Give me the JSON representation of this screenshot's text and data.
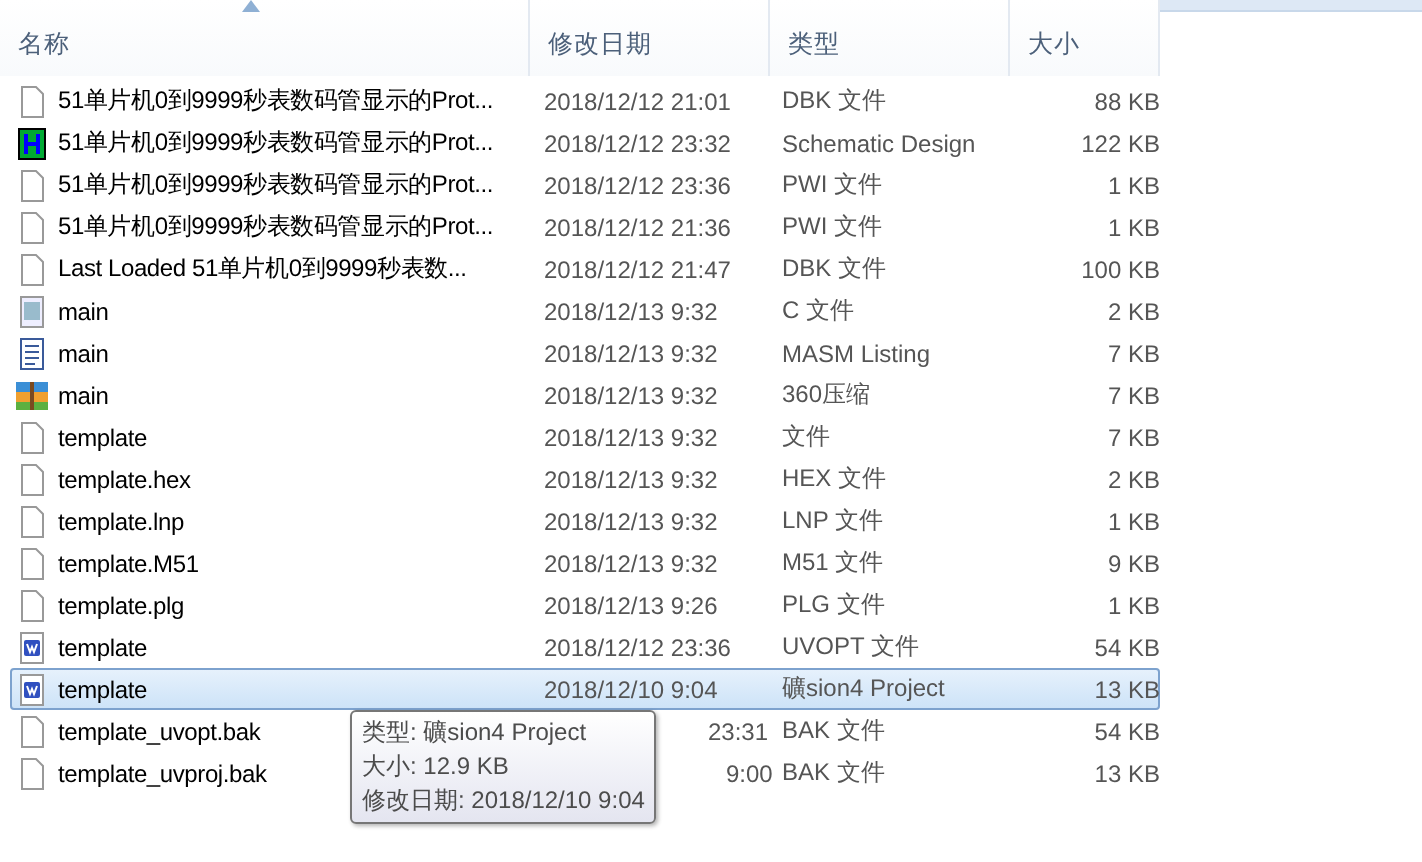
{
  "columns": [
    {
      "label": "名称",
      "sorted": true
    },
    {
      "label": "修改日期",
      "sorted": false
    },
    {
      "label": "类型",
      "sorted": false
    },
    {
      "label": "大小",
      "sorted": false
    }
  ],
  "rows": [
    {
      "kind": "file",
      "name": "51单片机0到9999秒表数码管显示的Prot...",
      "date": "2018/12/12 21:01",
      "type": "DBK 文件",
      "size": "88 KB",
      "selected": false
    },
    {
      "kind": "schematic",
      "name": "51单片机0到9999秒表数码管显示的Prot...",
      "date": "2018/12/12 23:32",
      "type": "Schematic Design",
      "size": "122 KB",
      "selected": false
    },
    {
      "kind": "file",
      "name": "51单片机0到9999秒表数码管显示的Prot...",
      "date": "2018/12/12 23:36",
      "type": "PWI 文件",
      "size": "1 KB",
      "selected": false
    },
    {
      "kind": "file",
      "name": "51单片机0到9999秒表数码管显示的Prot...",
      "date": "2018/12/12 21:36",
      "type": "PWI 文件",
      "size": "1 KB",
      "selected": false
    },
    {
      "kind": "file",
      "name": "Last Loaded 51单片机0到9999秒表数...",
      "date": "2018/12/12 21:47",
      "type": "DBK 文件",
      "size": "100 KB",
      "selected": false
    },
    {
      "kind": "c",
      "name": "main",
      "date": "2018/12/13 9:32",
      "type": "C 文件",
      "size": "2 KB",
      "selected": false
    },
    {
      "kind": "listing",
      "name": "main",
      "date": "2018/12/13 9:32",
      "type": "MASM Listing",
      "size": "7 KB",
      "selected": false
    },
    {
      "kind": "archive",
      "name": "main",
      "date": "2018/12/13 9:32",
      "type": "360压缩",
      "size": "7 KB",
      "selected": false
    },
    {
      "kind": "file",
      "name": "template",
      "date": "2018/12/13 9:32",
      "type": "文件",
      "size": "7 KB",
      "selected": false
    },
    {
      "kind": "file",
      "name": "template.hex",
      "date": "2018/12/13 9:32",
      "type": "HEX 文件",
      "size": "2 KB",
      "selected": false
    },
    {
      "kind": "file",
      "name": "template.lnp",
      "date": "2018/12/13 9:32",
      "type": "LNP 文件",
      "size": "1 KB",
      "selected": false
    },
    {
      "kind": "file",
      "name": "template.M51",
      "date": "2018/12/13 9:32",
      "type": "M51 文件",
      "size": "9 KB",
      "selected": false
    },
    {
      "kind": "file",
      "name": "template.plg",
      "date": "2018/12/13 9:26",
      "type": "PLG 文件",
      "size": "1 KB",
      "selected": false
    },
    {
      "kind": "uv",
      "name": "template",
      "date": "2018/12/12 23:36",
      "type": "UVOPT 文件",
      "size": "54 KB",
      "selected": false
    },
    {
      "kind": "uv",
      "name": "template",
      "date": "2018/12/10 9:04",
      "type": "礦sion4 Project",
      "size": "13 KB",
      "selected": true
    },
    {
      "kind": "file",
      "name": "template_uvopt.bak",
      "date": "23:31",
      "type": "BAK 文件",
      "size": "54 KB",
      "selected": false
    },
    {
      "kind": "file",
      "name": "template_uvproj.bak",
      "date": "9:00",
      "type": "BAK 文件",
      "size": "13 KB",
      "selected": false
    }
  ],
  "tooltip": {
    "lines": [
      "类型: 礦sion4 Project",
      "大小: 12.9 KB",
      "修改日期: 2018/12/10 9:04"
    ]
  }
}
